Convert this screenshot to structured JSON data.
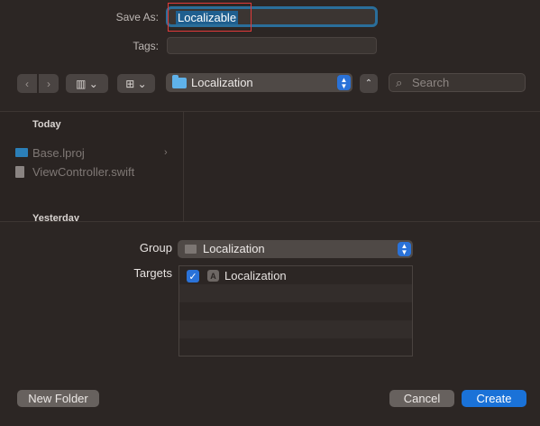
{
  "save_as": {
    "label": "Save As:",
    "value": "Localizable"
  },
  "tags": {
    "label": "Tags:",
    "value": ""
  },
  "toolbar": {
    "back_icon": "‹",
    "forward_icon": "›",
    "view_icon": "▥ ⌄",
    "group_icon": "⊞ ⌄",
    "location": "Localization",
    "expand_icon": "⌃",
    "search_placeholder": "Search"
  },
  "browser": {
    "sections": [
      {
        "title": "Today",
        "items": [
          {
            "name": "Base.lproj",
            "kind": "folder",
            "has_children": true
          },
          {
            "name": "ViewController.swift",
            "kind": "file",
            "has_children": false
          }
        ]
      },
      {
        "title": "Yesterday",
        "items": []
      }
    ],
    "chevron": "›"
  },
  "options": {
    "group_label": "Group",
    "group_value": "Localization",
    "targets_label": "Targets",
    "targets": [
      {
        "name": "Localization",
        "checked": true
      }
    ],
    "checkmark": "✓",
    "app_icon_glyph": "A"
  },
  "buttons": {
    "new_folder": "New Folder",
    "cancel": "Cancel",
    "create": "Create"
  },
  "colors": {
    "accent": "#1a72d8",
    "selection": "#1f5f8f",
    "highlight_box": "#e23a3a"
  }
}
